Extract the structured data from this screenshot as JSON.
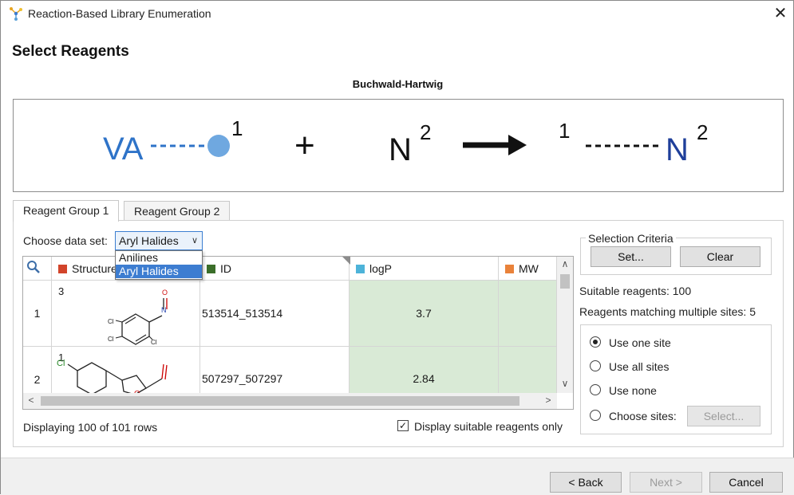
{
  "window": {
    "title": "Reaction-Based Library Enumeration",
    "close_glyph": "✕"
  },
  "page": {
    "heading": "Select Reagents"
  },
  "reaction": {
    "name": "Buchwald-Hartwig",
    "left_label": "VA",
    "site1": "1",
    "plus": "+",
    "reagent2_atom": "N",
    "site2": "2",
    "product_site1": "1",
    "product_atom": "N",
    "product_site2": "2",
    "blue": "#2e73c8",
    "light_blue": "#6fa8e0",
    "navy": "#1f3f9a"
  },
  "tabs": [
    {
      "label": "Reagent Group 1",
      "active": true
    },
    {
      "label": "Reagent Group 2",
      "active": false
    }
  ],
  "dataset": {
    "label": "Choose data set:",
    "value": "Aryl Halides",
    "options": [
      "Anilines",
      "Aryl Halides"
    ]
  },
  "table": {
    "columns": [
      {
        "label": "Structure",
        "color": "#d2442a"
      },
      {
        "label": "ID",
        "color": "#3b6e2a"
      },
      {
        "label": "logP",
        "color": "#4db3d9"
      },
      {
        "label": "MW",
        "color": "#e9823a"
      }
    ],
    "rows": [
      {
        "index": "1",
        "tag": "3",
        "id": "513514_513514",
        "logP": "3.7",
        "atoms": [
          "Cl",
          "Cl",
          "Cl",
          "N",
          "O"
        ]
      },
      {
        "index": "2",
        "tag": "1",
        "id": "507297_507297",
        "logP": "2.84",
        "atoms": [
          "Cl",
          "O"
        ]
      }
    ],
    "green": "#d9ead6"
  },
  "footer_left": {
    "displaying": "Displaying 100 of 101 rows"
  },
  "suitable_only": {
    "label": "Display suitable reagents only",
    "checked": true
  },
  "criteria": {
    "legend": "Selection Criteria",
    "set_label": "Set...",
    "clear_label": "Clear",
    "suitable": "Suitable reagents: 100",
    "multiple": "Reagents matching multiple sites: 5",
    "options": [
      {
        "label": "Use one site",
        "selected": true
      },
      {
        "label": "Use all sites",
        "selected": false
      },
      {
        "label": "Use none",
        "selected": false
      },
      {
        "label": "Choose sites:",
        "selected": false
      }
    ],
    "select_label": "Select..."
  },
  "buttons": {
    "back": "< Back",
    "next": "Next >",
    "cancel": "Cancel"
  }
}
